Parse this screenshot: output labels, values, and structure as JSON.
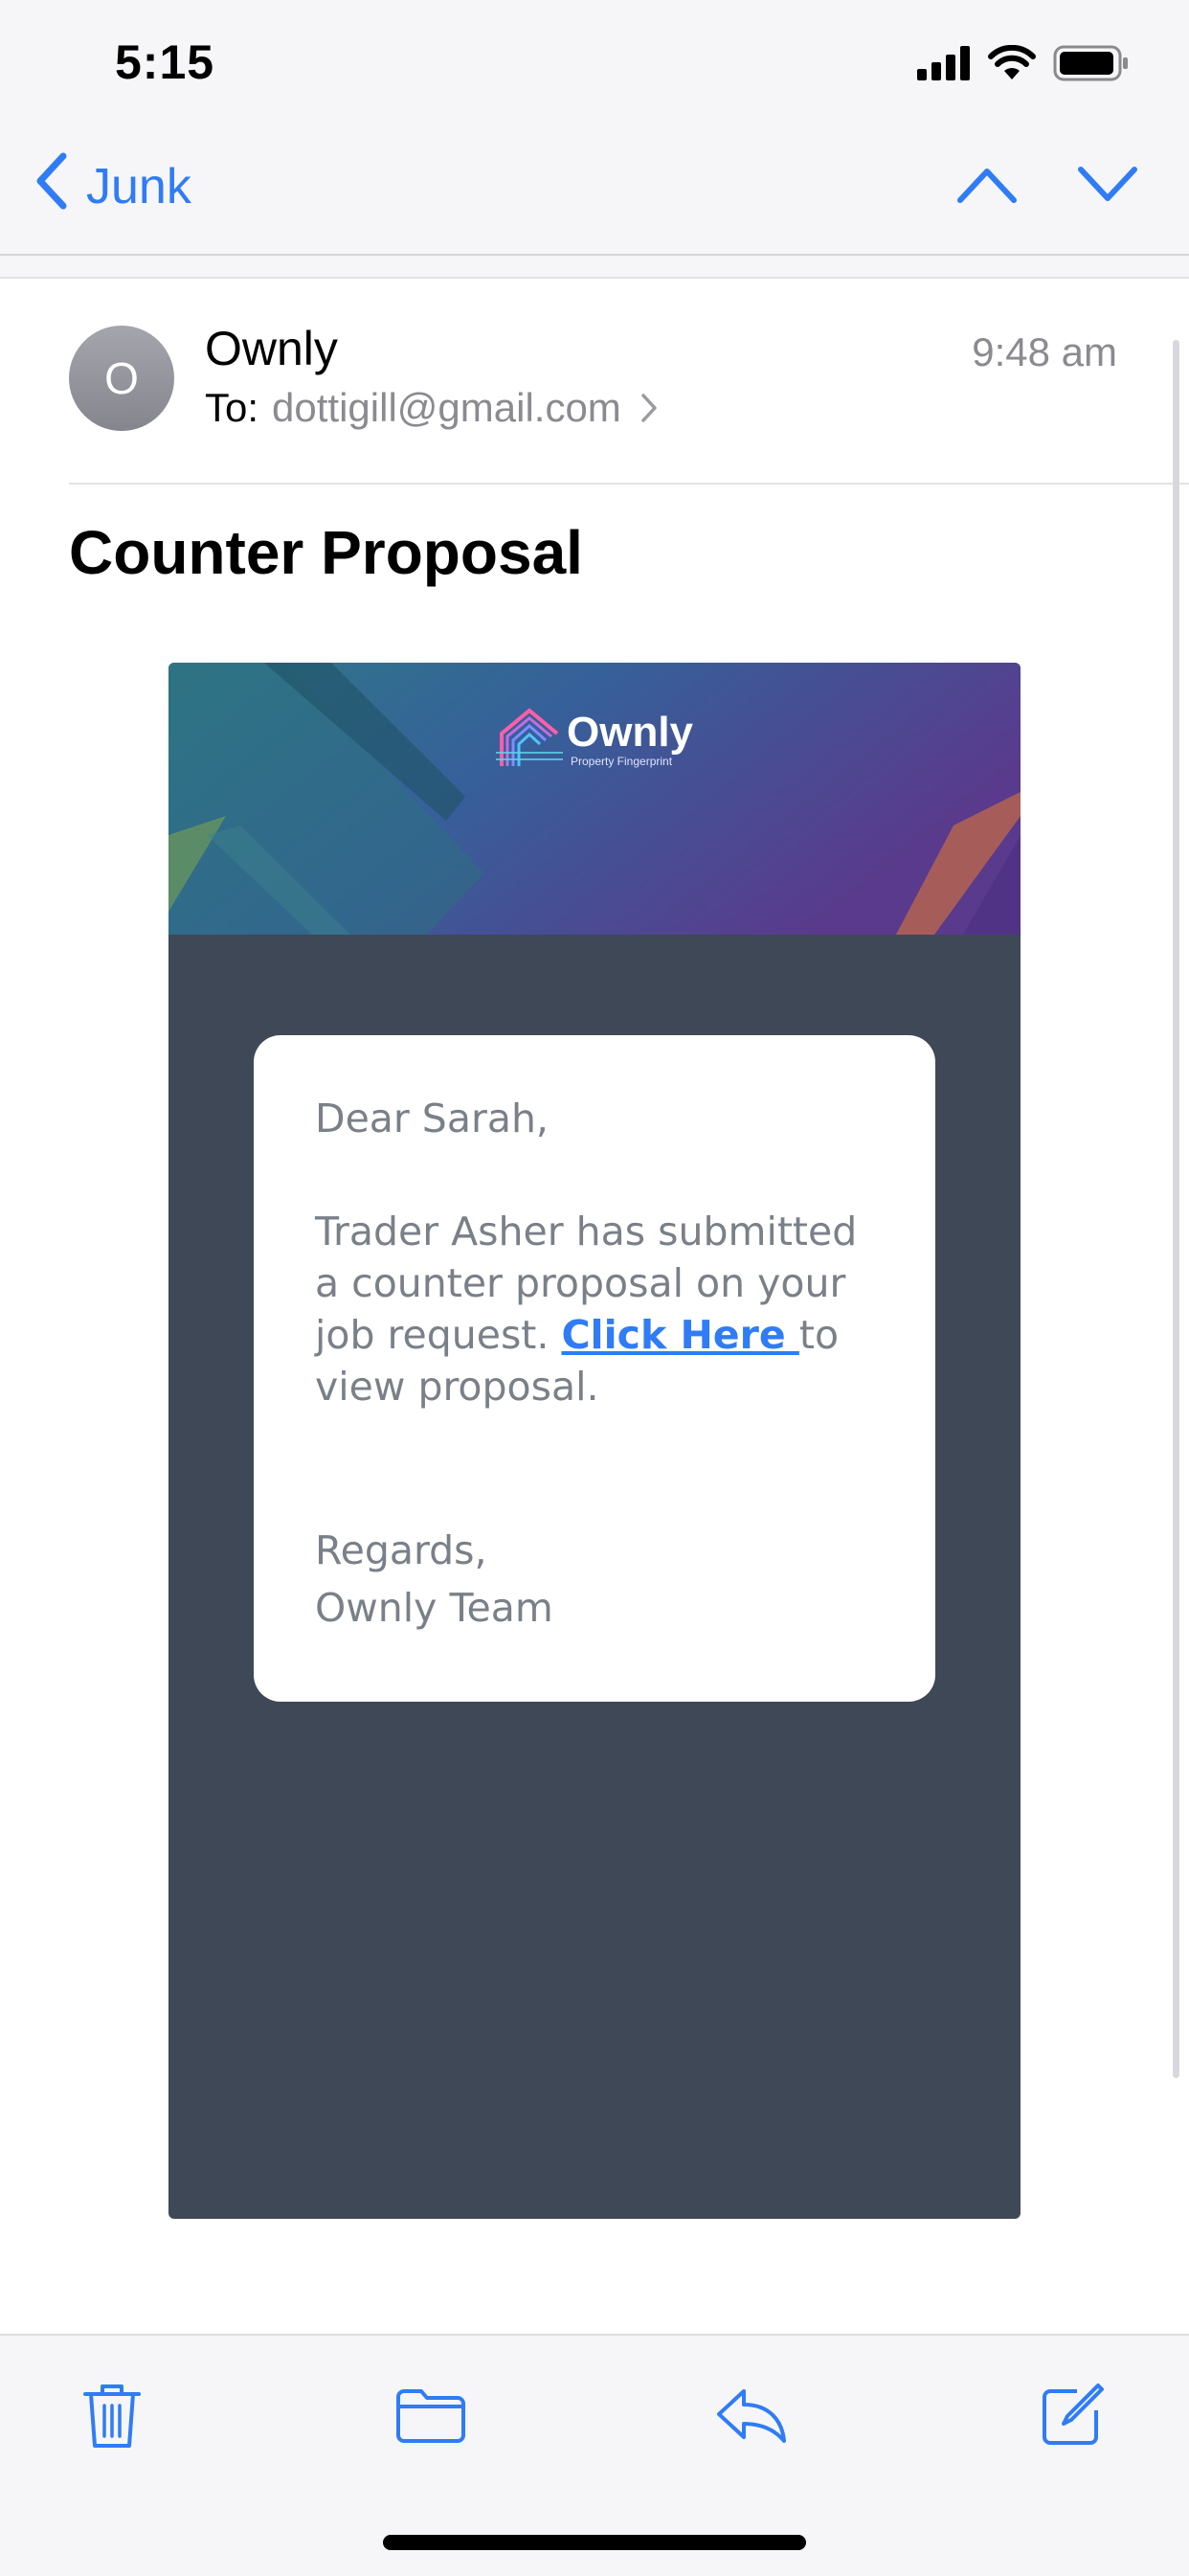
{
  "status_bar": {
    "time": "5:15",
    "icons": [
      "cellular-signal-icon",
      "wifi-icon",
      "battery-icon"
    ]
  },
  "navigation": {
    "back_label": "Junk",
    "back_icon": "chevron-left-icon",
    "prev_icon": "chevron-up-icon",
    "next_icon": "chevron-down-icon"
  },
  "message": {
    "avatar_initial": "O",
    "sender": "Ownly",
    "to_label": "To:",
    "to_address": "dottigill@gmail.com",
    "time": "9:48 am",
    "subject": "Counter Proposal"
  },
  "email_body": {
    "logo_text": "Ownly",
    "logo_tagline": "Property Fingerprint",
    "greeting": "Dear Sarah,",
    "message_prefix": "Trader Asher has submitted a counter proposal on your job request. ",
    "link_text": "Click Here ",
    "message_suffix": "to view proposal.",
    "regards": "Regards,",
    "signature": "Ownly Team"
  },
  "toolbar": {
    "items": [
      "trash-icon",
      "folder-icon",
      "reply-icon",
      "compose-icon"
    ]
  },
  "colors": {
    "accent": "#2f7cf6",
    "email_background": "#3e4857",
    "body_text": "#7a8088"
  }
}
